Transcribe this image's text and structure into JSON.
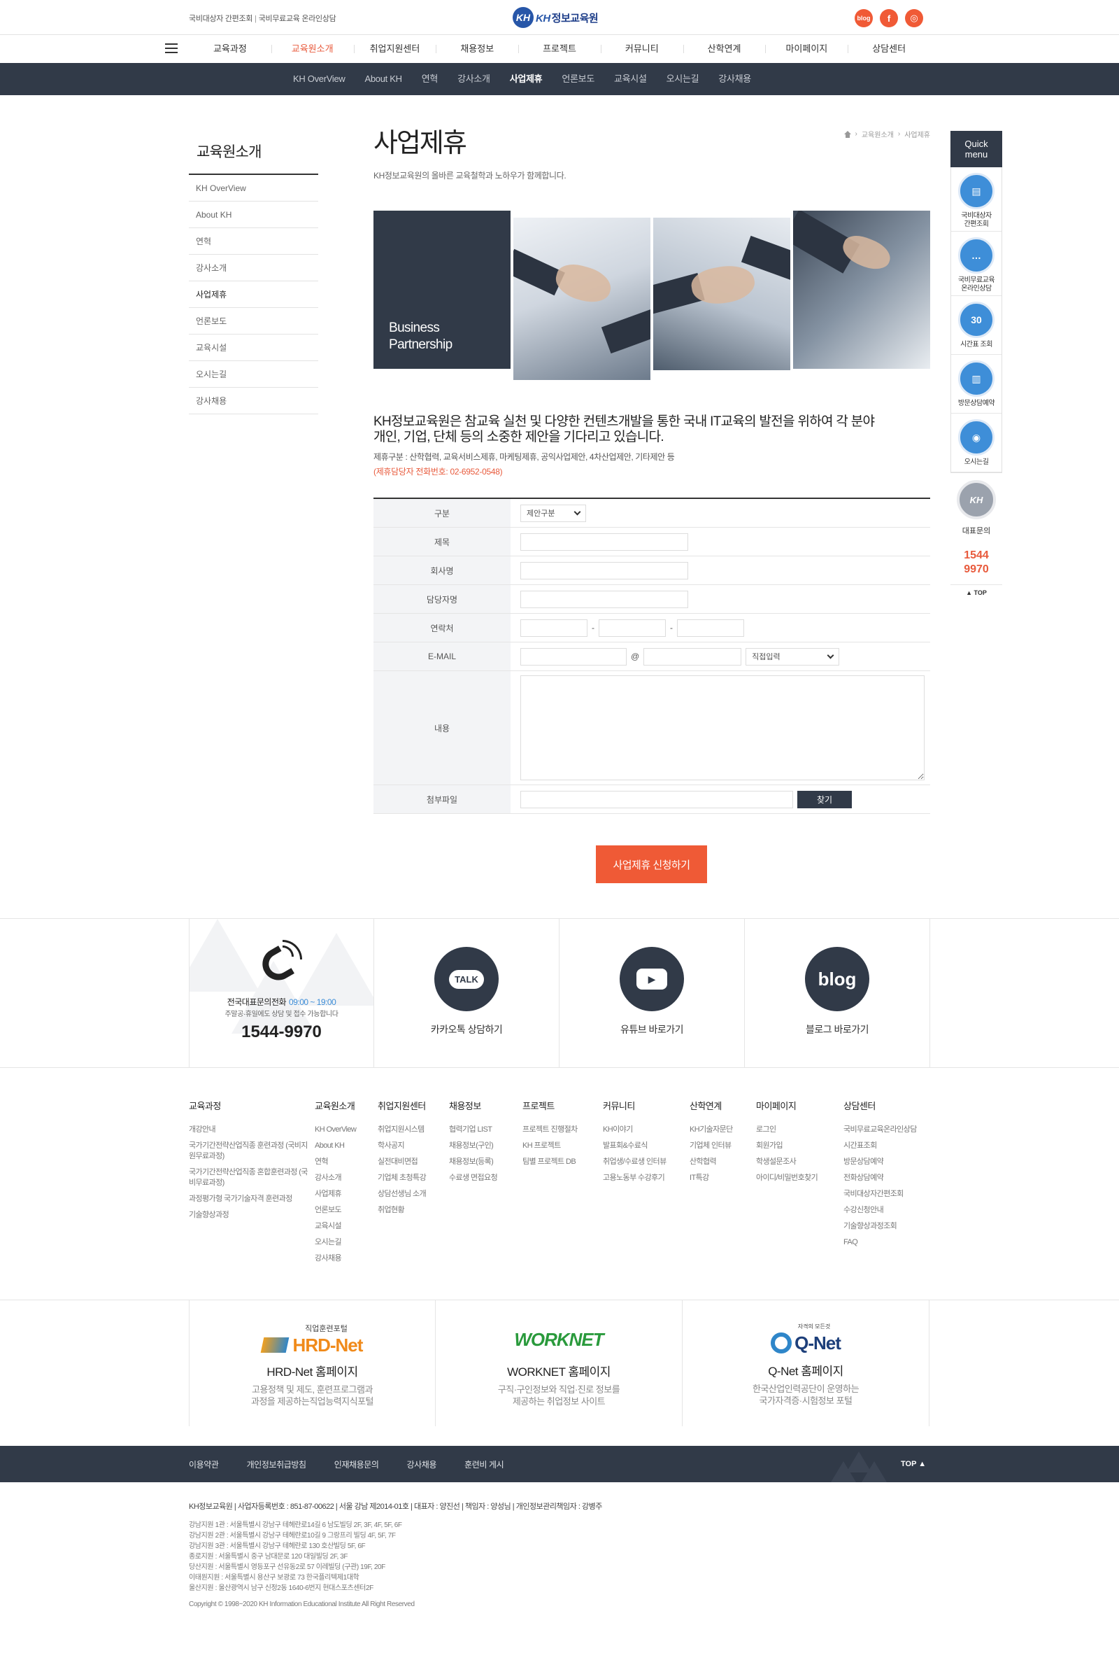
{
  "header": {
    "top_links": [
      "국비대상자 간편조회",
      "국비무료교육 온라인상담"
    ],
    "logo_mark": "KH",
    "logo_text": "KH",
    "logo_name": "정보교육원",
    "sns": [
      "blog",
      "f",
      "◎"
    ]
  },
  "gnb": [
    "교육과정",
    "교육원소개",
    "취업지원센터",
    "채용정보",
    "프로젝트",
    "커뮤니티",
    "산학연계",
    "마이페이지",
    "상담센터"
  ],
  "gnb_active": 1,
  "lnb": [
    "KH OverView",
    "About KH",
    "연혁",
    "강사소개",
    "사업제휴",
    "언론보도",
    "교육시설",
    "오시는길",
    "강사채용"
  ],
  "lnb_active": 4,
  "side": {
    "title": "교육원소개",
    "items": [
      "KH OverView",
      "About KH",
      "연혁",
      "강사소개",
      "사업제휴",
      "언론보도",
      "교육시설",
      "오시는길",
      "강사채용"
    ]
  },
  "page": {
    "title": "사업제휴",
    "desc": "KH정보교육원의 올바른 교육철학과 노하우가 함께합니다.",
    "breadcrumb": [
      "교육원소개",
      "사업제휴"
    ]
  },
  "hero": {
    "line1": "Business",
    "line2": "Partnership"
  },
  "intro": {
    "main1": "KH정보교육원은 참교육 실천 및 다양한 컨텐츠개발을 통한 국내 IT교육의 발전을 위하여 각 분야",
    "main2": "개인, 기업, 단체 등의 소중한 제안을 기다리고 있습니다.",
    "sub": "제휴구분 : 산학협력, 교육서비스제휴, 마케팅제휴, 공익사업제안, 4차산업제안, 기타제안 등",
    "tel": "(제휴담당자 전화번호: 02-6952-0548)"
  },
  "form": {
    "labels": {
      "category": "구분",
      "subject": "제목",
      "company": "회사명",
      "manager": "담당자명",
      "contact": "연락처",
      "email": "E-MAIL",
      "body": "내용",
      "file": "첨부파일"
    },
    "category_value": "제안구분",
    "email_domain_value": "직접입력",
    "dash": "-",
    "at": "@",
    "find_label": "찾기",
    "submit_label": "사업제휴 신청하기"
  },
  "quick": {
    "title1": "Quick",
    "title2": "menu",
    "items": [
      {
        "label1": "국비대상자",
        "label2": "간편조회",
        "glyph": "▤"
      },
      {
        "label1": "국비무료교육",
        "label2": "온라인상담",
        "glyph": "…"
      },
      {
        "label1": "시간표 조회",
        "label2": "",
        "glyph": "30"
      },
      {
        "label1": "방문상담예약",
        "label2": "",
        "glyph": "▥"
      },
      {
        "label1": "오시는길",
        "label2": "",
        "glyph": "◉"
      }
    ],
    "rep_mark": "KH",
    "rep_label": "대표문의",
    "rep_num1": "1544",
    "rep_num2": "9970",
    "top_label": "TOP"
  },
  "band": {
    "tel_title": "전국대표문의전화",
    "tel_hours": "09:00 ~ 19:00",
    "tel_note": "주말공·휴일에도 상담 및 접수 가능합니다",
    "tel_num": "1544-9970",
    "items": [
      {
        "glyph": "TALK",
        "label": "카카오톡 상담하기"
      },
      {
        "glyph": "▶",
        "label": "유튜브 바로가기"
      },
      {
        "glyph": "blog",
        "label": "블로그 바로가기"
      }
    ]
  },
  "sitemap": [
    {
      "title": "교육과정",
      "items": [
        "개강안내",
        "국가기간전략산업직종 훈련과정 (국비지원무료과정)",
        "국가기간전략산업직종 혼합훈련과정 (국비무료과정)",
        "과정평가형 국가기술자격 훈련과정",
        "기술향상과정"
      ]
    },
    {
      "title": "교육원소개",
      "items": [
        "KH OverView",
        "About KH",
        "연혁",
        "강사소개",
        "사업제휴",
        "언론보도",
        "교육시설",
        "오시는길",
        "강사채용"
      ]
    },
    {
      "title": "취업지원센터",
      "items": [
        "취업지원시스템",
        "학사공지",
        "실전대비면접",
        "기업체 초청특강",
        "상담선생님 소개",
        "취업현황"
      ]
    },
    {
      "title": "채용정보",
      "items": [
        "협력기업 LIST",
        "채용정보(구인)",
        "채용정보(등록)",
        "수료생 면접요청"
      ]
    },
    {
      "title": "프로젝트",
      "items": [
        "프로젝트 진행절차",
        "KH 프로젝트",
        "팀별 프로젝트 DB"
      ]
    },
    {
      "title": "커뮤니티",
      "items": [
        "KH이야기",
        "발표회&수료식",
        "취업생/수료생 인터뷰",
        "고용노동부 수강후기"
      ]
    },
    {
      "title": "산학연계",
      "items": [
        "KH기술자문단",
        "기업체 인터뷰",
        "산학협력",
        "IT특강"
      ]
    },
    {
      "title": "마이페이지",
      "items": [
        "로그인",
        "회원가입",
        "학생설문조사",
        "아이디/비밀번호찾기"
      ]
    },
    {
      "title": "상담센터",
      "items": [
        "국비무료교육온라인상담",
        "시간표조회",
        "방문상담예약",
        "전화상담예약",
        "국비대상자간편조회",
        "수강신청안내",
        "기술향상과정조회",
        "FAQ"
      ]
    }
  ],
  "partners": [
    {
      "top": "직업훈련포털",
      "logo": "HRD-Net",
      "title": "HRD-Net 홈페이지",
      "desc1": "고용정책 및 제도, 훈련프로그램과",
      "desc2": "과정을 제공하는직업능력지식포털"
    },
    {
      "top": "",
      "logo": "WORKNET",
      "title": "WORKNET 홈페이지",
      "desc1": "구직·구인정보와 직업·진로 정보를",
      "desc2": "제공하는 취업정보 사이트"
    },
    {
      "top": "자격의 모든것",
      "logo": "Q-Net",
      "title": "Q-Net 홈페이지",
      "desc1": "한국산업인력공단이 운영하는",
      "desc2": "국가자격증·시험정보 포털"
    }
  ],
  "footer": {
    "links": [
      "이용약관",
      "개인정보취급방침",
      "인재채용문의",
      "강사채용",
      "훈련비 게시"
    ],
    "top": "TOP",
    "company": "KH정보교육원  |  사업자등록번호 : 851-87-00622  |  서울 강남 제2014-01호  |  대표자 : 양진선  |  책임자 : 양성님  |  개인정보관리책임자 : 강병주",
    "addresses": [
      "강남지원 1관 : 서울특별시 강남구 테헤란로14길 6 남도빌딩 2F, 3F, 4F, 5F, 6F",
      "강남지원 2관 : 서울특별시 강남구 테헤란로10길 9 그랑프리 빌딩 4F, 5F, 7F",
      "강남지원 3관 : 서울특별시 강남구 테헤란로 130 호산빌딩 5F, 6F",
      "종로지원 : 서울특별시 중구 남대문로 120 대일빌딩 2F, 3F",
      "당산지원 : 서울특별시 영등포구 선유동2로 57 이레빌딩 (구관) 19F, 20F",
      "이태원지원 : 서울특별시 용산구 보광로 73 한국플리텍제1대학",
      "울산지원 : 울산광역시 남구 신정2동 1640-6번지 현대스포츠센터2F"
    ],
    "copyright": "Copyright © 1998~2020 KH Information Educational Institute All Right Reserved"
  },
  "colors": {
    "accent": "#ef5a36",
    "navy": "#313a48",
    "blue": "#3e8ed8"
  }
}
